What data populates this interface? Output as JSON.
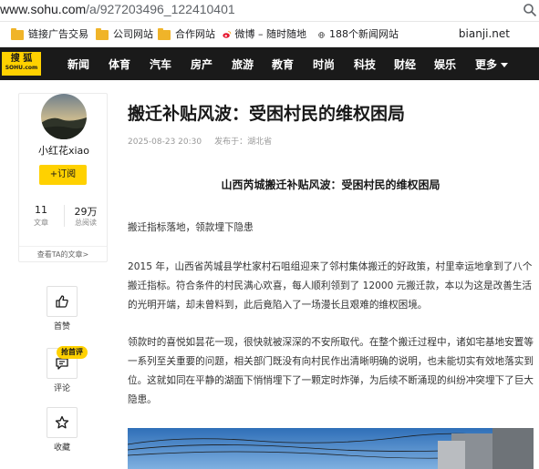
{
  "browser": {
    "url_host": "www.sohu.com",
    "url_path": "/a/927203496_122410401"
  },
  "bookmarks": {
    "items": [
      {
        "label": "链接广告交易",
        "icon": "folder-icon"
      },
      {
        "label": "公司网站",
        "icon": "folder-icon"
      },
      {
        "label": "合作网站",
        "icon": "folder-icon"
      },
      {
        "label": "微博 – 随时随地",
        "icon": "weibo-icon"
      },
      {
        "label": "188个新闻网站",
        "icon": "globe-icon"
      }
    ],
    "right_label": "bianji.net"
  },
  "nav": {
    "logo_main": "搜 狐",
    "logo_sub": "SOHU.com",
    "items": [
      "新闻",
      "体育",
      "汽车",
      "房产",
      "旅游",
      "教育",
      "时尚",
      "科技",
      "财经",
      "娱乐",
      "更多"
    ]
  },
  "author": {
    "name": "小红花xiao",
    "follow_label": "+订阅",
    "articles_count": "11",
    "articles_label": "文章",
    "views_count": "29万",
    "views_label": "总阅读",
    "see_more": "查看TA的文章>"
  },
  "side_actions": {
    "like_label": "首赞",
    "comment_label": "评论",
    "comment_tag": "抢首评",
    "collect_label": "收藏"
  },
  "article": {
    "title": "搬迁补贴风波：受困村民的维权困局",
    "date": "2025-08-23 20:30",
    "source": "发布于：湖北省",
    "subhead": "山西芮城搬迁补贴风波：受困村民的维权困局",
    "paragraphs": [
      "搬迁指标落地，领款埋下隐患",
      "2015 年，山西省芮城县学杜家村石咀组迎来了邻村集体搬迁的好政策，村里幸运地拿到了八个搬迁指标。符合条件的村民满心欢喜，每人顺利领到了 12000 元搬迁款，本以为这是改善生活的光明开端，却未曾料到，此后竟陷入了一场漫长且艰难的维权困境。",
      "领款时的喜悦如昙花一现，很快就被深深的不安所取代。在整个搬迁过程中，诸如宅基地安置等一系列至关重要的问题，相关部门既没有向村民作出清晰明确的说明，也未能切实有效地落实到位。这就如同在平静的湖面下悄悄埋下了一颗定时炸弹，为后续不断涌现的纠纷冲突埋下了巨大隐患。"
    ]
  },
  "colors": {
    "accent": "#ffd100",
    "nav_bg": "#1a1a1a"
  }
}
